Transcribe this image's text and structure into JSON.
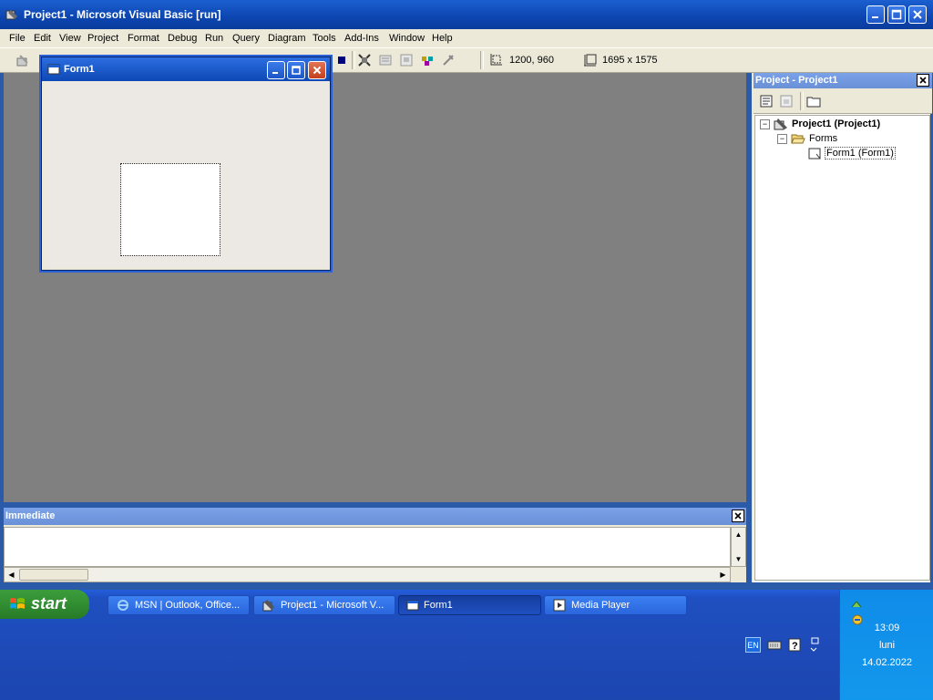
{
  "window": {
    "title": "Project1 - Microsoft Visual Basic [run]"
  },
  "menu": [
    "File",
    "Edit",
    "View",
    "Project",
    "Format",
    "Debug",
    "Run",
    "Query",
    "Diagram",
    "Tools",
    "Add-Ins",
    "Window",
    "Help"
  ],
  "toolbar": {
    "position": "1200, 960",
    "size": "1695 x 1575"
  },
  "form1": {
    "title": "Form1"
  },
  "immediate": {
    "title": "Immediate"
  },
  "project": {
    "title": "Project - Project1",
    "tree": {
      "root": "Project1 (Project1)",
      "folder": "Forms",
      "item": "Form1 (Form1)"
    }
  },
  "taskbar": {
    "start": "start",
    "tasks": [
      "MSN | Outlook, Office...",
      "Project1 - Microsoft V...",
      "Form1",
      "Media Player"
    ],
    "lang": "EN",
    "time": "13:09",
    "day": "luni",
    "date": "14.02.2022"
  },
  "colors": {
    "titlebar": "#0c45b0",
    "taskbar": "#1f4fc0",
    "start": "#2f8a2f",
    "mdi": "#808080"
  }
}
